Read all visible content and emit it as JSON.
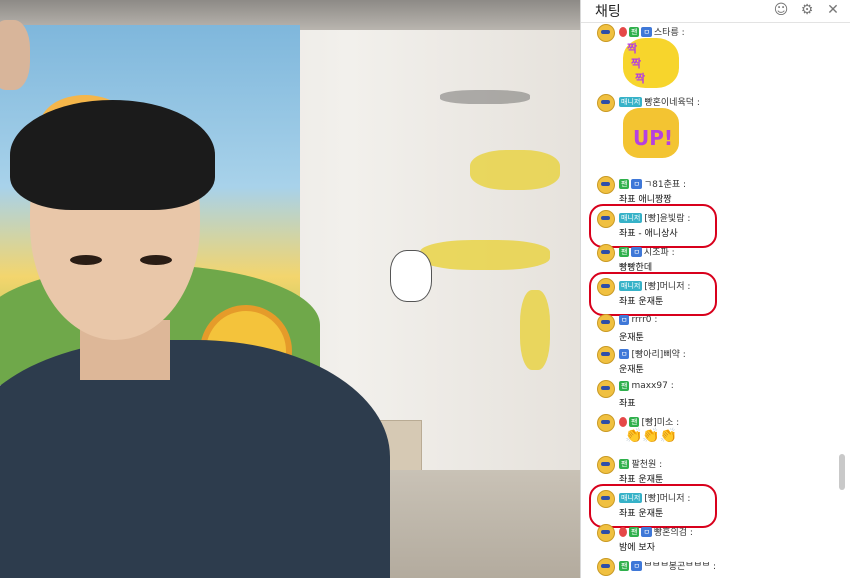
{
  "chat": {
    "title": "채팅",
    "icons": {
      "user": "user-list-icon",
      "settings": "gear-icon",
      "close": "close-icon"
    }
  },
  "messages": [
    {
      "nick": "스타릉 :",
      "badges": [
        "heart",
        "fan",
        "sub"
      ],
      "text": "",
      "sticker": "짝짝짝"
    },
    {
      "nick": "빵혼이네육덕 :",
      "badges": [
        "mgr"
      ],
      "text": "",
      "sticker": "UP!"
    },
    {
      "nick": "ㄱ81춘표 :",
      "badges": [
        "fan",
        "sub"
      ],
      "text": "좌표 애니짱짱"
    },
    {
      "nick": "[빵]윤빛람 :",
      "badges": [
        "mgr"
      ],
      "text": "좌표 - 애니상사"
    },
    {
      "nick": "시조파 :",
      "badges": [
        "fan",
        "sub"
      ],
      "text": "빵빵한데"
    },
    {
      "nick": "[빵]머니저 :",
      "badges": [
        "mgr"
      ],
      "text": "좌표 운재툰"
    },
    {
      "nick": "rrrr0 :",
      "badges": [
        "sub"
      ],
      "text": "운재툰"
    },
    {
      "nick": "[빵아리]삐약 :",
      "badges": [
        "sub"
      ],
      "text": "운재툰"
    },
    {
      "nick": "maxx97 :",
      "badges": [
        "fan"
      ],
      "text": "좌표"
    },
    {
      "nick": "[빵]미소 :",
      "badges": [
        "heart",
        "fan"
      ],
      "text": "",
      "clap": "👏👏👏"
    },
    {
      "nick": "팔천원 :",
      "badges": [
        "fan"
      ],
      "text": "좌표 운재툰"
    },
    {
      "nick": "[빵]머니저 :",
      "badges": [
        "mgr"
      ],
      "text": "좌표 운재툰"
    },
    {
      "nick": "빵혼의검 :",
      "badges": [
        "heart",
        "fan",
        "sub"
      ],
      "text": "밤에 보자"
    },
    {
      "nick": "ᄇᄇᄇ봉곤ᄇᄇᄇ :",
      "badges": [
        "fan",
        "sub"
      ],
      "text": ""
    }
  ],
  "badge_labels": {
    "fan": "팬",
    "sub": "ㅁ",
    "mgr": "매니저",
    "heart": ""
  },
  "colors": {
    "highlight": "#d8001c",
    "fan": "#2fb04c",
    "sub": "#3f78d8",
    "manager": "#37b2c8"
  }
}
